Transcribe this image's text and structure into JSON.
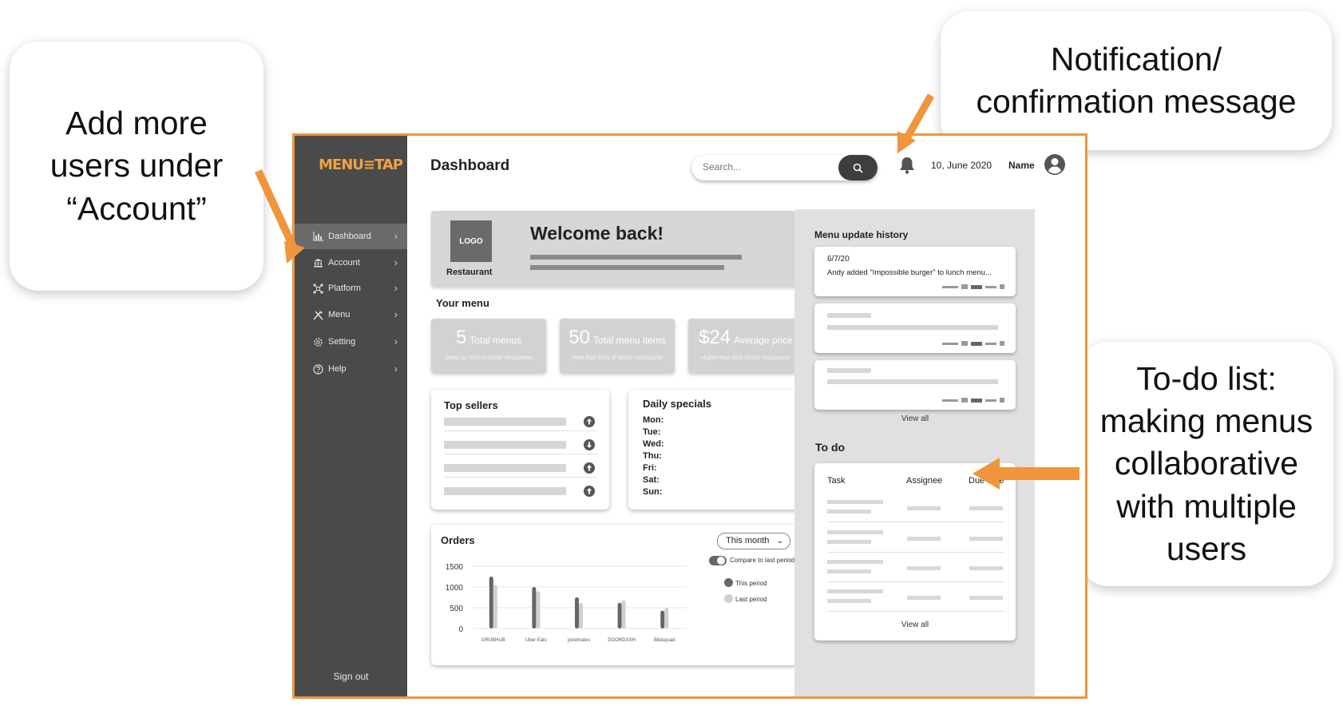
{
  "callouts": {
    "account": [
      "Add more",
      "users under",
      "“Account”"
    ],
    "notification": [
      "Notification/",
      "confirmation message"
    ],
    "todo": [
      "To-do list:",
      "making menus",
      "collaborative",
      "with multiple",
      "users"
    ]
  },
  "app": {
    "logo_menu": "MENU",
    "logo_tap": "TAP",
    "sidebar": {
      "items": [
        {
          "label": "Dashboard",
          "icon": "bar-chart-icon"
        },
        {
          "label": "Account",
          "icon": "bank-icon"
        },
        {
          "label": "Platform",
          "icon": "network-icon"
        },
        {
          "label": "Menu",
          "icon": "utensils-icon"
        },
        {
          "label": "Setting",
          "icon": "gear-icon"
        },
        {
          "label": "Help",
          "icon": "help-icon"
        }
      ],
      "sign_out": "Sign out"
    },
    "header": {
      "title": "Dashboard",
      "search_placeholder": "Search...",
      "date": "10, June 2020",
      "name": "Name"
    },
    "welcome": {
      "logo_text": "LOGO",
      "restaurant": "Restaurant",
      "message": "Welcome back!"
    },
    "your_menu": {
      "label": "Your menu",
      "stats": [
        {
          "value": "5",
          "label": "Total menus",
          "sub": "Same as 70% of similar restaurants"
        },
        {
          "value": "50",
          "label": "Total menu items",
          "sub": "More than 60% of similar restaurants"
        },
        {
          "value": "$24",
          "label": "Average price",
          "sub": "Higher than 30% similar restaurants"
        }
      ]
    },
    "top_sellers": {
      "title": "Top sellers",
      "trends": [
        "up",
        "down",
        "up",
        "up"
      ]
    },
    "daily_specials": {
      "title": "Daily specials",
      "days": [
        "Mon:",
        "Tue:",
        "Wed:",
        "Thu:",
        "Fri:",
        "Sat:",
        "Sun:"
      ]
    },
    "orders": {
      "title": "Orders",
      "period": "This month",
      "compare_label": "Compare to last period",
      "legend_this": "This period",
      "legend_last": "Last period"
    },
    "menu_history": {
      "title": "Menu update history",
      "first_date": "6/7/20",
      "first_text": "Andy added \"Impossible burger\" to lunch menu...",
      "view_all": "View all"
    },
    "todo": {
      "title": "To do",
      "headers": [
        "Task",
        "Assignee",
        "Due date"
      ],
      "view_all": "View all"
    }
  },
  "colors": {
    "accent": "#f0953b",
    "sidebar": "#4a4a4a",
    "this_period": "#666666",
    "last_period": "#d0d0d0"
  },
  "chart_data": {
    "type": "bar",
    "categories": [
      "GRUBHUB",
      "Uber Eats",
      "postmates",
      "DOORDASH",
      "Bitesquad"
    ],
    "series": [
      {
        "name": "This period",
        "values": [
          1250,
          1000,
          750,
          620,
          430
        ]
      },
      {
        "name": "Last period",
        "values": [
          1050,
          900,
          620,
          680,
          500
        ]
      }
    ],
    "yticks": [
      "1500",
      "1000",
      "500",
      "0"
    ],
    "ylim": [
      0,
      1500
    ]
  }
}
